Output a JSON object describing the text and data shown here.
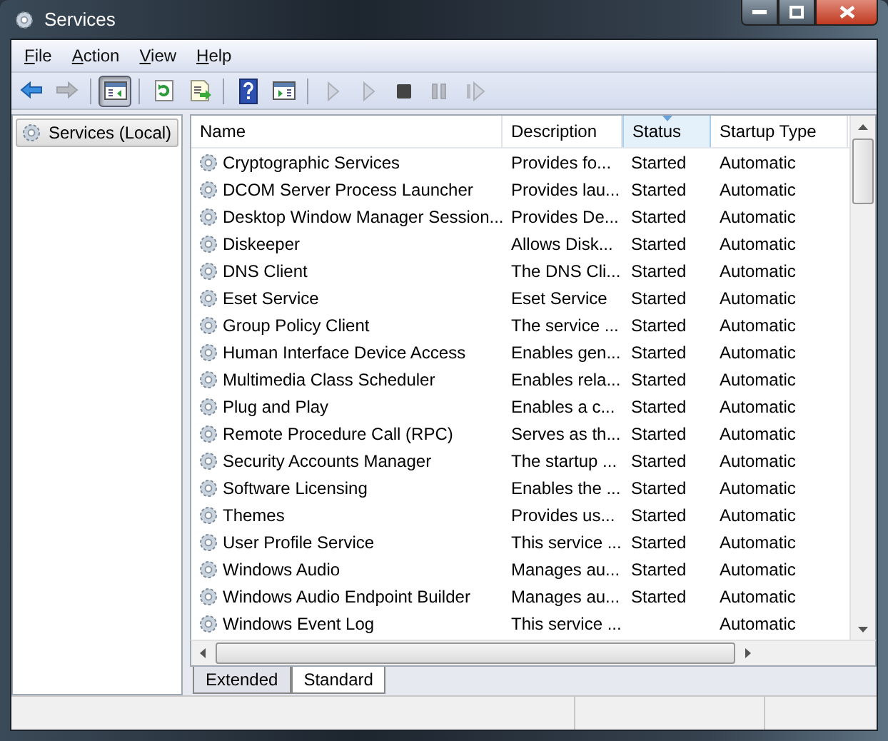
{
  "window": {
    "title": "Services"
  },
  "menu": [
    {
      "label": "File"
    },
    {
      "label": "Action"
    },
    {
      "label": "View"
    },
    {
      "label": "Help"
    }
  ],
  "toolbar": [
    {
      "kind": "back",
      "disabled": false,
      "pressed": false
    },
    {
      "kind": "forward",
      "disabled": true,
      "pressed": false
    },
    {
      "kind": "sep"
    },
    {
      "kind": "tree",
      "disabled": false,
      "pressed": true
    },
    {
      "kind": "sep"
    },
    {
      "kind": "refresh",
      "disabled": false,
      "pressed": false
    },
    {
      "kind": "export",
      "disabled": false,
      "pressed": false
    },
    {
      "kind": "sep"
    },
    {
      "kind": "help",
      "disabled": false,
      "pressed": false
    },
    {
      "kind": "pane",
      "disabled": false,
      "pressed": false
    },
    {
      "kind": "sep"
    },
    {
      "kind": "play",
      "disabled": true,
      "pressed": false
    },
    {
      "kind": "play",
      "disabled": true,
      "pressed": false
    },
    {
      "kind": "stop",
      "disabled": false,
      "pressed": false
    },
    {
      "kind": "pause",
      "disabled": true,
      "pressed": false
    },
    {
      "kind": "restart",
      "disabled": true,
      "pressed": false
    }
  ],
  "sidebar": {
    "items": [
      {
        "label": "Services (Local)",
        "selected": true
      }
    ]
  },
  "table": {
    "columns": [
      {
        "label": "Name",
        "sorted": false
      },
      {
        "label": "Description",
        "sorted": false
      },
      {
        "label": "Status",
        "sorted": true
      },
      {
        "label": "Startup Type",
        "sorted": false
      }
    ],
    "rows": [
      {
        "name": "Cryptographic Services",
        "description": "Provides fo...",
        "status": "Started",
        "startup_type": "Automatic"
      },
      {
        "name": "DCOM Server Process Launcher",
        "description": "Provides lau...",
        "status": "Started",
        "startup_type": "Automatic"
      },
      {
        "name": "Desktop Window Manager Session...",
        "description": "Provides De...",
        "status": "Started",
        "startup_type": "Automatic"
      },
      {
        "name": "Diskeeper",
        "description": "Allows Disk...",
        "status": "Started",
        "startup_type": "Automatic"
      },
      {
        "name": "DNS Client",
        "description": "The DNS Cli...",
        "status": "Started",
        "startup_type": "Automatic"
      },
      {
        "name": "Eset Service",
        "description": "Eset Service",
        "status": "Started",
        "startup_type": "Automatic"
      },
      {
        "name": "Group Policy Client",
        "description": "The service ...",
        "status": "Started",
        "startup_type": "Automatic"
      },
      {
        "name": "Human Interface Device Access",
        "description": "Enables gen...",
        "status": "Started",
        "startup_type": "Automatic"
      },
      {
        "name": "Multimedia Class Scheduler",
        "description": "Enables rela...",
        "status": "Started",
        "startup_type": "Automatic"
      },
      {
        "name": "Plug and Play",
        "description": "Enables a c...",
        "status": "Started",
        "startup_type": "Automatic"
      },
      {
        "name": "Remote Procedure Call (RPC)",
        "description": "Serves as th...",
        "status": "Started",
        "startup_type": "Automatic"
      },
      {
        "name": "Security Accounts Manager",
        "description": "The startup ...",
        "status": "Started",
        "startup_type": "Automatic"
      },
      {
        "name": "Software Licensing",
        "description": "Enables the ...",
        "status": "Started",
        "startup_type": "Automatic"
      },
      {
        "name": "Themes",
        "description": "Provides us...",
        "status": "Started",
        "startup_type": "Automatic"
      },
      {
        "name": "User Profile Service",
        "description": "This service ...",
        "status": "Started",
        "startup_type": "Automatic"
      },
      {
        "name": "Windows Audio",
        "description": "Manages au...",
        "status": "Started",
        "startup_type": "Automatic"
      },
      {
        "name": "Windows Audio Endpoint Builder",
        "description": "Manages au...",
        "status": "Started",
        "startup_type": "Automatic"
      },
      {
        "name": "Windows Event Log",
        "description": "This service ...",
        "startup_type": "Automatic"
      }
    ]
  },
  "view_tabs": [
    {
      "label": "Extended",
      "selected": false
    },
    {
      "label": "Standard",
      "selected": true
    }
  ]
}
